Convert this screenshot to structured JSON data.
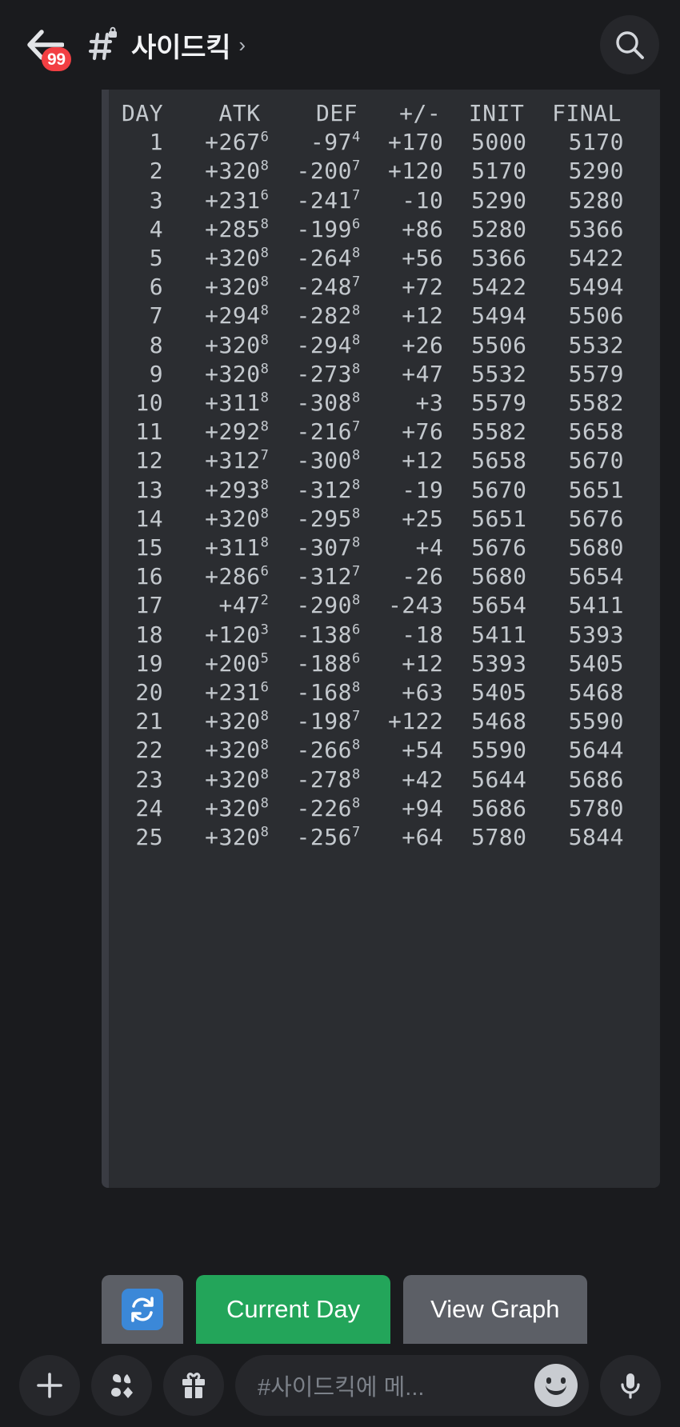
{
  "header": {
    "back_icon": "back-arrow-icon",
    "unread_badge": "99",
    "channel_icon": "hash-lock-icon",
    "channel_name": "사이드킥",
    "chevron": "›",
    "search_icon": "search-icon"
  },
  "message": {
    "code_block": {
      "columns": [
        "DAY",
        "ATK",
        "DEF",
        "+/-",
        "INIT",
        "FINAL"
      ],
      "rows": [
        {
          "day": "1",
          "atk": "+267",
          "atk_sup": "6",
          "def": "-97",
          "def_sup": "4",
          "delta": "+170",
          "init": "5000",
          "final": "5170"
        },
        {
          "day": "2",
          "atk": "+320",
          "atk_sup": "8",
          "def": "-200",
          "def_sup": "7",
          "delta": "+120",
          "init": "5170",
          "final": "5290"
        },
        {
          "day": "3",
          "atk": "+231",
          "atk_sup": "6",
          "def": "-241",
          "def_sup": "7",
          "delta": "-10",
          "init": "5290",
          "final": "5280"
        },
        {
          "day": "4",
          "atk": "+285",
          "atk_sup": "8",
          "def": "-199",
          "def_sup": "6",
          "delta": "+86",
          "init": "5280",
          "final": "5366"
        },
        {
          "day": "5",
          "atk": "+320",
          "atk_sup": "8",
          "def": "-264",
          "def_sup": "8",
          "delta": "+56",
          "init": "5366",
          "final": "5422"
        },
        {
          "day": "6",
          "atk": "+320",
          "atk_sup": "8",
          "def": "-248",
          "def_sup": "7",
          "delta": "+72",
          "init": "5422",
          "final": "5494"
        },
        {
          "day": "7",
          "atk": "+294",
          "atk_sup": "8",
          "def": "-282",
          "def_sup": "8",
          "delta": "+12",
          "init": "5494",
          "final": "5506"
        },
        {
          "day": "8",
          "atk": "+320",
          "atk_sup": "8",
          "def": "-294",
          "def_sup": "8",
          "delta": "+26",
          "init": "5506",
          "final": "5532"
        },
        {
          "day": "9",
          "atk": "+320",
          "atk_sup": "8",
          "def": "-273",
          "def_sup": "8",
          "delta": "+47",
          "init": "5532",
          "final": "5579"
        },
        {
          "day": "10",
          "atk": "+311",
          "atk_sup": "8",
          "def": "-308",
          "def_sup": "8",
          "delta": "+3",
          "init": "5579",
          "final": "5582"
        },
        {
          "day": "11",
          "atk": "+292",
          "atk_sup": "8",
          "def": "-216",
          "def_sup": "7",
          "delta": "+76",
          "init": "5582",
          "final": "5658"
        },
        {
          "day": "12",
          "atk": "+312",
          "atk_sup": "7",
          "def": "-300",
          "def_sup": "8",
          "delta": "+12",
          "init": "5658",
          "final": "5670"
        },
        {
          "day": "13",
          "atk": "+293",
          "atk_sup": "8",
          "def": "-312",
          "def_sup": "8",
          "delta": "-19",
          "init": "5670",
          "final": "5651"
        },
        {
          "day": "14",
          "atk": "+320",
          "atk_sup": "8",
          "def": "-295",
          "def_sup": "8",
          "delta": "+25",
          "init": "5651",
          "final": "5676"
        },
        {
          "day": "15",
          "atk": "+311",
          "atk_sup": "8",
          "def": "-307",
          "def_sup": "8",
          "delta": "+4",
          "init": "5676",
          "final": "5680"
        },
        {
          "day": "16",
          "atk": "+286",
          "atk_sup": "6",
          "def": "-312",
          "def_sup": "7",
          "delta": "-26",
          "init": "5680",
          "final": "5654"
        },
        {
          "day": "17",
          "atk": "+47",
          "atk_sup": "2",
          "def": "-290",
          "def_sup": "8",
          "delta": "-243",
          "init": "5654",
          "final": "5411"
        },
        {
          "day": "18",
          "atk": "+120",
          "atk_sup": "3",
          "def": "-138",
          "def_sup": "6",
          "delta": "-18",
          "init": "5411",
          "final": "5393"
        },
        {
          "day": "19",
          "atk": "+200",
          "atk_sup": "5",
          "def": "-188",
          "def_sup": "6",
          "delta": "+12",
          "init": "5393",
          "final": "5405"
        },
        {
          "day": "20",
          "atk": "+231",
          "atk_sup": "6",
          "def": "-168",
          "def_sup": "8",
          "delta": "+63",
          "init": "5405",
          "final": "5468"
        },
        {
          "day": "21",
          "atk": "+320",
          "atk_sup": "8",
          "def": "-198",
          "def_sup": "7",
          "delta": "+122",
          "init": "5468",
          "final": "5590"
        },
        {
          "day": "22",
          "atk": "+320",
          "atk_sup": "8",
          "def": "-266",
          "def_sup": "8",
          "delta": "+54",
          "init": "5590",
          "final": "5644"
        },
        {
          "day": "23",
          "atk": "+320",
          "atk_sup": "8",
          "def": "-278",
          "def_sup": "8",
          "delta": "+42",
          "init": "5644",
          "final": "5686"
        },
        {
          "day": "24",
          "atk": "+320",
          "atk_sup": "8",
          "def": "-226",
          "def_sup": "8",
          "delta": "+94",
          "init": "5686",
          "final": "5780"
        },
        {
          "day": "25",
          "atk": "+320",
          "atk_sup": "8",
          "def": "-256",
          "def_sup": "7",
          "delta": "+64",
          "init": "5780",
          "final": "5844"
        }
      ]
    }
  },
  "actions": {
    "refresh_icon": "repeat-icon",
    "current_day_label": "Current Day",
    "view_graph_label": "View Graph",
    "primary_color": "#23a55a",
    "secondary_color": "#5c5f66"
  },
  "composer": {
    "add_icon": "plus-icon",
    "apps_icon": "sticker-icon",
    "gift_icon": "gift-icon",
    "placeholder": "#사이드킥에 메...",
    "emoji_icon": "smiley-icon",
    "mic_icon": "microphone-icon"
  }
}
